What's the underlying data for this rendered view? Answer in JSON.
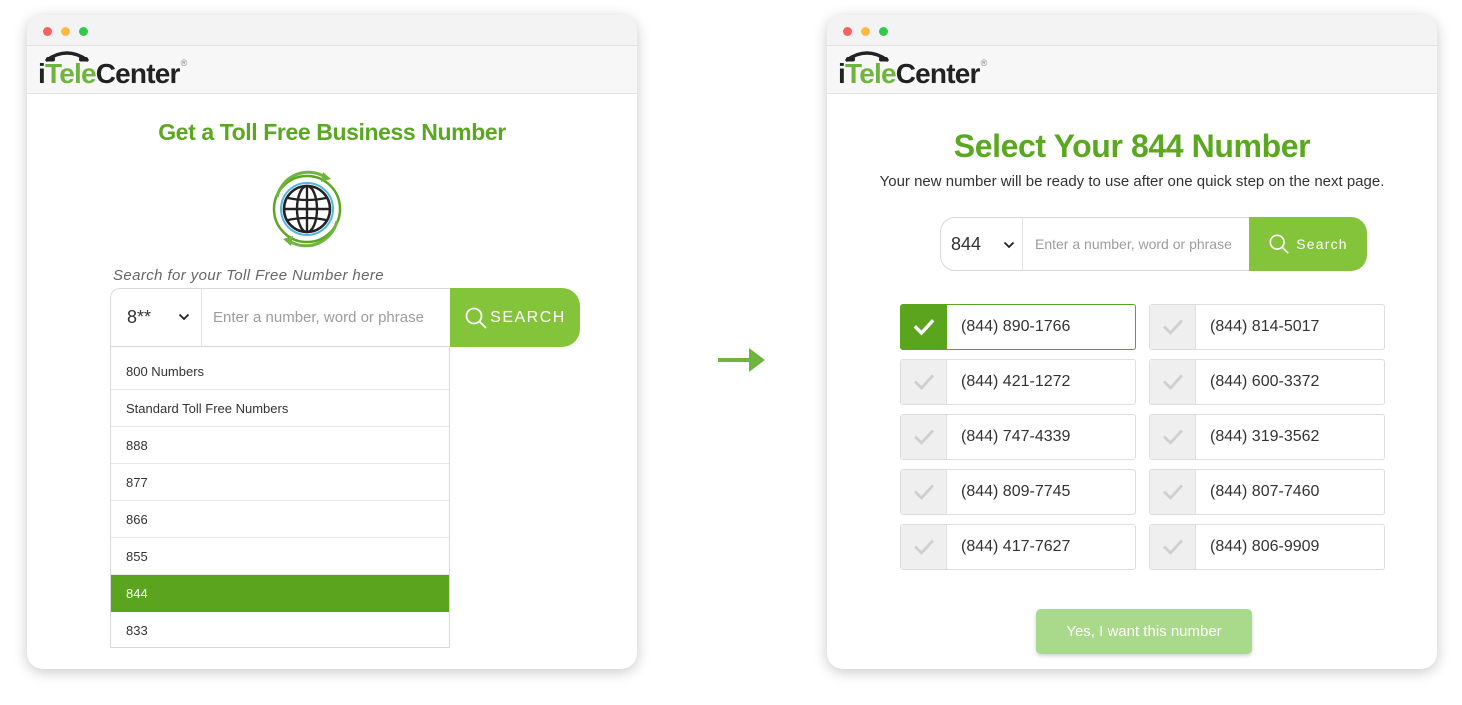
{
  "brand": {
    "logo_part1": "i",
    "logo_part2": "Tele",
    "logo_part3": "Center",
    "logo_reg": "®",
    "accent": "#5aa820",
    "button_green": "#84c43b"
  },
  "left": {
    "title": "Get a Toll Free Business Number",
    "globe_icon": "globe-icon",
    "search_hint": "Search for your Toll Free Number here",
    "prefix_select": "8**",
    "input_placeholder": "Enter a number, word or phrase",
    "search_label": "SEARCH",
    "dropdown": [
      "800 Numbers",
      "Standard Toll Free Numbers",
      "888",
      "877",
      "866",
      "855",
      "844",
      "833"
    ],
    "dropdown_selected": 6
  },
  "right": {
    "title": "Select Your 844 Number",
    "subtitle": "Your new number will be ready to use after one quick step on the next page.",
    "prefix_select": "844",
    "input_placeholder": "Enter a number, word or phrase",
    "search_label": "Search",
    "numbers": [
      [
        "(844) 890-1766",
        "(844) 814-5017"
      ],
      [
        "(844) 421-1272",
        "(844) 600-3372"
      ],
      [
        "(844) 747-4339",
        "(844) 319-3562"
      ],
      [
        "(844) 809-7745",
        "(844) 807-7460"
      ],
      [
        "(844) 417-7627",
        "(844) 806-9909"
      ]
    ],
    "selected_number": "(844) 890-1766",
    "confirm_label": "Yes, I want this number"
  }
}
